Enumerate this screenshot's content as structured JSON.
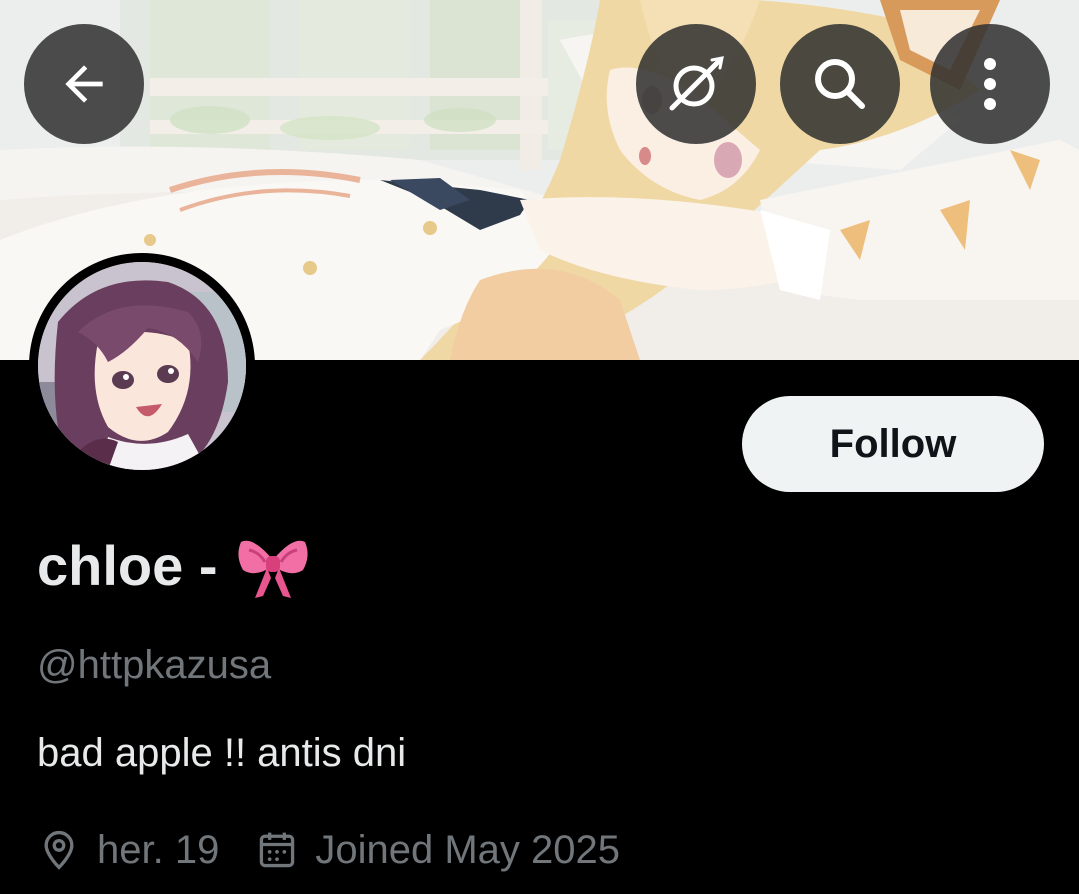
{
  "header": {
    "back_icon": "arrow-left-icon",
    "grok_icon": "grok-icon",
    "search_icon": "search-icon",
    "more_icon": "more-vertical-icon"
  },
  "profile": {
    "display_name": "chloe -",
    "name_emoji": "ribbon-bow-emoji",
    "handle": "@httpkazusa",
    "bio": "bad apple !! antis dni",
    "location": "her. 19",
    "joined": "Joined May 2025"
  },
  "actions": {
    "follow_label": "Follow"
  },
  "colors": {
    "background": "#000000",
    "primary_text": "#e7e9ea",
    "secondary_text": "#71767b",
    "follow_bg": "#eff3f4",
    "follow_text": "#0f1419",
    "overlay_button": "#303030"
  }
}
